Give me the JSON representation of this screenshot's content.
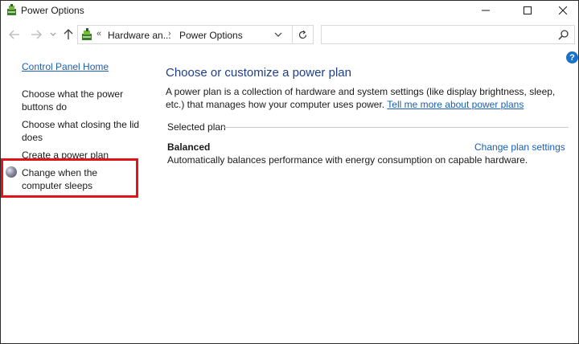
{
  "window": {
    "title": "Power Options"
  },
  "address": {
    "crumbs": [
      "Hardware an...",
      "Power Options"
    ],
    "chevron": "«",
    "separator": "›"
  },
  "search": {
    "placeholder": ""
  },
  "help": {
    "glyph": "?"
  },
  "sidebar": {
    "home": "Control Panel Home",
    "items": [
      "Choose what the power buttons do",
      "Choose what closing the lid does",
      "Create a power plan",
      "Change when the computer sleeps"
    ]
  },
  "main": {
    "title": "Choose or customize a power plan",
    "description": "A power plan is a collection of hardware and system settings (like display brightness, sleep, etc.) that manages how your computer uses power.",
    "description_link": "Tell me more about power plans",
    "section_label": "Selected plan",
    "plan": {
      "name": "Balanced",
      "settings_link": "Change plan settings",
      "description": "Automatically balances performance with energy consumption on capable hardware."
    }
  },
  "colors": {
    "highlight": "#e0151b",
    "link": "#1a5fb4",
    "heading": "#1e3e8c"
  },
  "icons": [
    "power-options-icon",
    "minimize-icon",
    "maximize-icon",
    "close-icon",
    "back-arrow-icon",
    "forward-arrow-icon",
    "recent-dropdown-icon",
    "up-arrow-icon",
    "chevron-down-icon",
    "refresh-icon",
    "search-icon",
    "help-icon",
    "moon-icon"
  ]
}
